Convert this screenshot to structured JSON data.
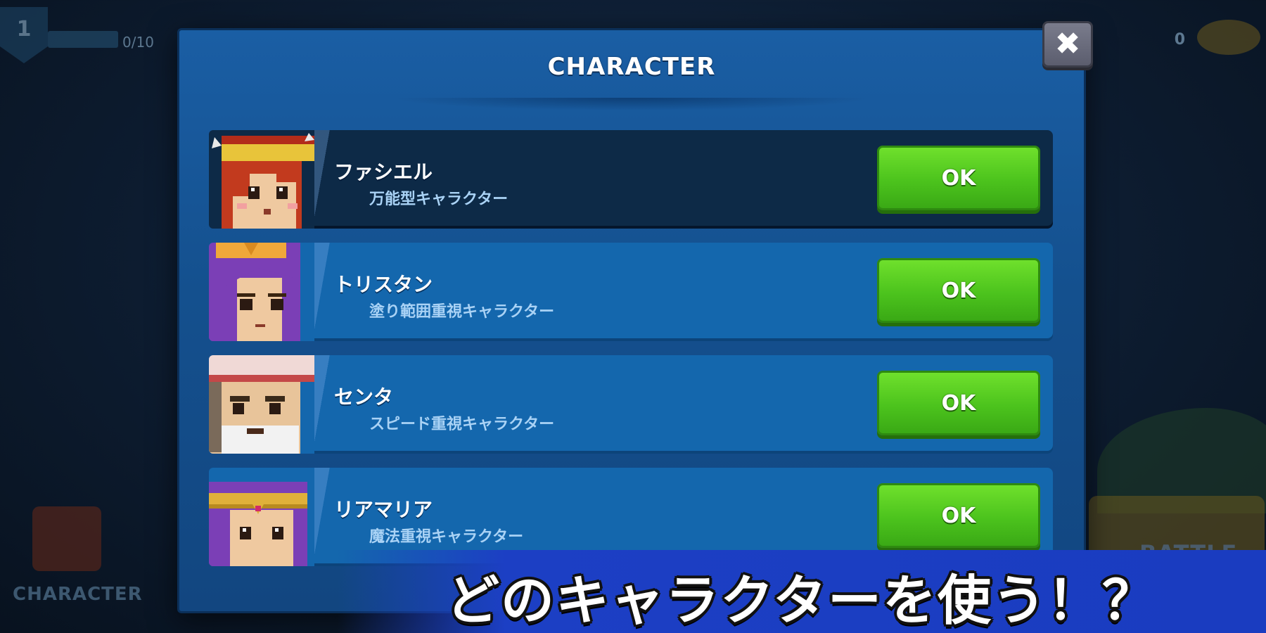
{
  "hud": {
    "level": "1",
    "xp": "0/10",
    "coins": "0",
    "character_button_label": "CHARACTER",
    "battle_button_label": "BATTLE"
  },
  "modal": {
    "title": "CHARACTER",
    "close_icon": "close-icon"
  },
  "characters": [
    {
      "name": "ファシエル",
      "description": "万能型キャラクター",
      "button": "OK",
      "selected": true
    },
    {
      "name": "トリスタン",
      "description": "塗り範囲重視キャラクター",
      "button": "OK",
      "selected": false
    },
    {
      "name": "センタ",
      "description": "スピード重視キャラクター",
      "button": "OK",
      "selected": false
    },
    {
      "name": "リアマリア",
      "description": "魔法重視キャラクター",
      "button": "OK",
      "selected": false
    }
  ],
  "caption": "どのキャラクターを使う！？",
  "colors": {
    "ok_green": "#4cc31d",
    "row_blue": "#1467ad",
    "row_selected": "#0d2a47",
    "caption_blue": "#1c3fc4"
  }
}
